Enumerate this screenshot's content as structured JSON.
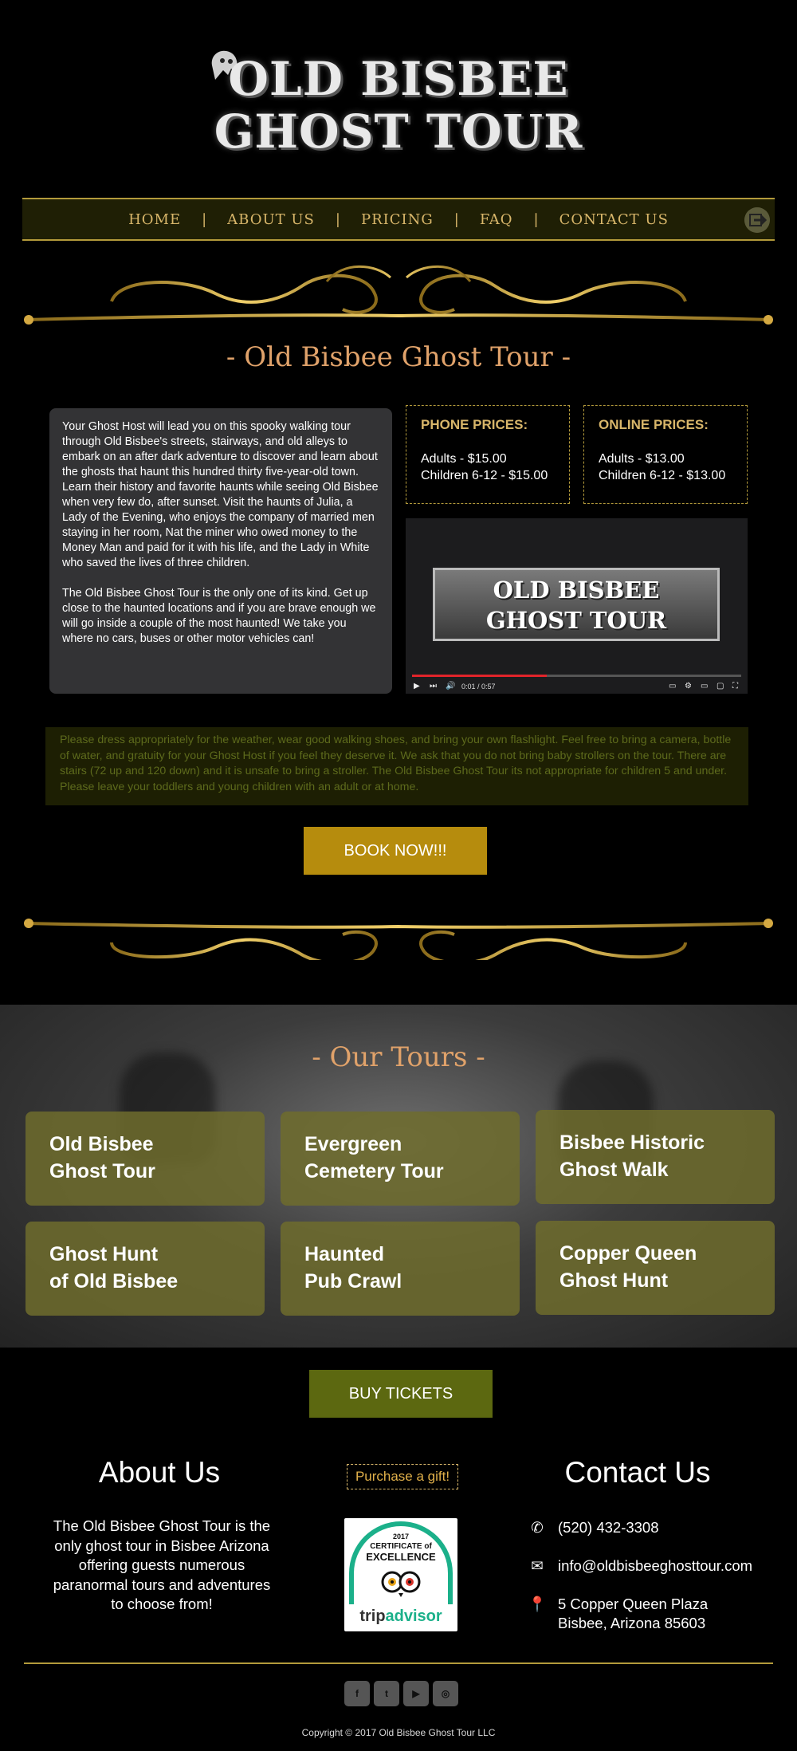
{
  "logo": {
    "line1": "OLD BISBEE",
    "line2": "GHOST TOUR"
  },
  "nav": {
    "items": [
      "HOME",
      "ABOUT US",
      "PRICING",
      "FAQ",
      "CONTACT US"
    ],
    "separator": "|"
  },
  "section_title": "- Old Bisbee Ghost Tour -",
  "intro": {
    "p1": "Your Ghost Host will lead you on this spooky walking tour through Old Bisbee's streets, stairways, and old alleys to embark on an after dark adventure to discover and learn about the ghosts that haunt this hundred thirty five-year-old town. Learn their history and favorite haunts while seeing Old Bisbee when very few do, after sunset. Visit the haunts of Julia, a Lady of the Evening, who enjoys the company of married men staying in her room, Nat the miner who owed money to the Money Man and paid for it with his life, and the Lady in White who saved the lives of three children.",
    "p2": "The Old Bisbee Ghost Tour is the only one of its kind. Get up close to the haunted locations and if you are brave enough we will go inside a couple of the most haunted! We take you where no cars, buses or other motor vehicles can!"
  },
  "phone_prices": {
    "title": "PHONE PRICES:",
    "adults": "Adults - $15.00",
    "children": "Children 6-12 - $15.00"
  },
  "online_prices": {
    "title": "ONLINE PRICES:",
    "adults": "Adults - $13.00",
    "children": "Children 6-12 - $13.00"
  },
  "video": {
    "card_line1": "OLD BISBEE",
    "card_line2": "GHOST TOUR",
    "time": "0:01 / 0:57",
    "progress": 0.41
  },
  "notice": "Please dress appropriately for the weather, wear good walking shoes, and bring your own flashlight.  Feel free to bring a camera, bottle of water, and gratuity for your Ghost Host if you feel they deserve it. We ask that you do not bring baby strollers on the tour. There are stairs (72 up and 120 down) and it is unsafe to bring a stroller. The Old Bisbee Ghost Tour its not appropriate for children 5 and under. Please leave your toddlers and young children with an adult or at home.",
  "book_button": "BOOK NOW!!!",
  "tours": {
    "title": "- Our Tours -",
    "cards": [
      {
        "line1": "Old Bisbee",
        "line2": "Ghost Tour"
      },
      {
        "line1": "Evergreen",
        "line2": "Cemetery Tour"
      },
      {
        "line1": "Bisbee Historic",
        "line2": "Ghost Walk"
      },
      {
        "line1": "Ghost Hunt",
        "line2": "of Old Bisbee"
      },
      {
        "line1": "Haunted",
        "line2": "Pub Crawl"
      },
      {
        "line1": "Copper Queen",
        "line2": "Ghost Hunt"
      }
    ]
  },
  "buy_button": "BUY TICKETS",
  "about": {
    "heading": "About Us",
    "text": "The Old Bisbee Ghost Tour is  the only ghost tour in Bisbee Arizona offering guests numerous paranormal tours and adventures to choose from!"
  },
  "gift_button": "Purchase a gift!",
  "tripadvisor": {
    "year": "2017",
    "certificate": "CERTIFICATE of",
    "excellence": "EXCELLENCE",
    "brand1": "trip",
    "brand2": "advisor"
  },
  "contact": {
    "heading": "Contact Us",
    "phone": "(520) 432-3308",
    "email": "info@oldbisbeeghosttour.com",
    "address_line1": "5 Copper Queen Plaza",
    "address_line2": "Bisbee, Arizona 85603"
  },
  "social": [
    "facebook-icon",
    "twitter-icon",
    "youtube-icon",
    "instagram-icon"
  ],
  "copyright": "Copyright © 2017 Old Bisbee Ghost Tour LLC",
  "colors": {
    "gold": "#d8b66a",
    "book_button": "#b68c0d",
    "buy_button": "#5c6810",
    "tour_card": "#6e6c2d"
  }
}
